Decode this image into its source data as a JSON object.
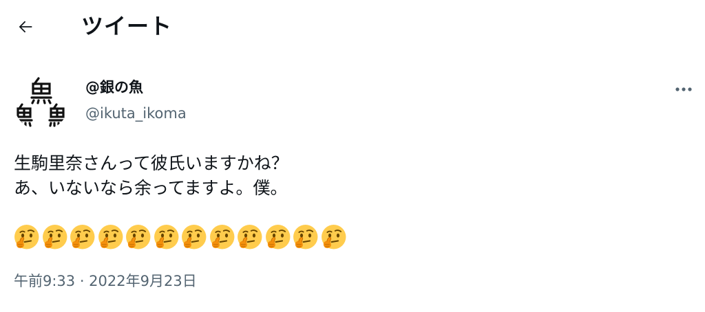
{
  "header": {
    "back_icon": "arrow-left-icon",
    "title": "ツイート"
  },
  "tweet": {
    "author": {
      "display_name": "@銀の魚",
      "handle": "@ikuta_ikoma",
      "avatar_icon": "kanji-avatar-icon"
    },
    "more_icon": "more-horizontal-icon",
    "text": "生駒里奈さんって彼氏いますかね？\nあ、いないなら余ってますよ。僕。",
    "emojis": [
      "🤔",
      "🤔",
      "🤔",
      "🤔",
      "🤔",
      "🤔",
      "🤔",
      "🤔",
      "🤔",
      "🤔",
      "🤔",
      "🤔"
    ],
    "timestamp": "午前9:33 · 2022年9月23日"
  },
  "colors": {
    "text_primary": "#0f1419",
    "text_secondary": "#536471",
    "emoji_face": "#FFCC4D"
  }
}
